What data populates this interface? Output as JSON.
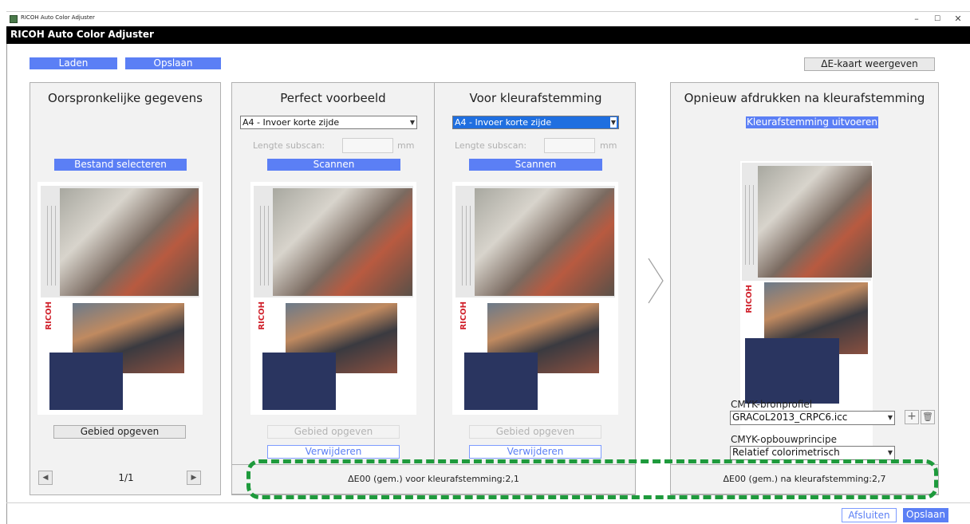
{
  "window": {
    "os_title": "RICOH Auto Color Adjuster",
    "app_title": "RICOH Auto Color Adjuster",
    "minimize": "–",
    "maximize": "☐",
    "close": "✕"
  },
  "toolbar": {
    "load_label": "Laden",
    "save_label": "Opslaan",
    "delta_e_map_label": "ΔE-kaart weergeven"
  },
  "original": {
    "title": "Oorspronkelijke gegevens",
    "select_file_label": "Bestand selecteren",
    "specify_area_label": "Gebied opgeven",
    "page_indicator": "1/1",
    "thumb_text": "RICOH"
  },
  "perfect": {
    "title": "Perfect voorbeeld",
    "paper_select": "A4 - Invoer korte zijde",
    "subscan_label": "Lengte subscan:",
    "subscan_unit": "mm",
    "scan_label": "Scannen",
    "specify_area_label": "Gebied opgeven",
    "delete_label": "Verwijderen",
    "thumb_text": "RICOH"
  },
  "before": {
    "title": "Voor kleurafstemming",
    "paper_select": "A4 - Invoer korte zijde",
    "subscan_label": "Lengte subscan:",
    "subscan_unit": "mm",
    "scan_label": "Scannen",
    "specify_area_label": "Gebied opgeven",
    "delete_label": "Verwijderen",
    "thumb_text": "RICOH"
  },
  "reprint": {
    "title": "Opnieuw afdrukken na kleurafstemming",
    "run_label": "Kleurafstemming uitvoeren",
    "cmyk_source_label": "CMYK-bronprofiel",
    "cmyk_source_value": "GRACoL2013_CRPC6.icc",
    "cmyk_build_label": "CMYK-opbouwprincipe",
    "cmyk_build_value": "Relatief colorimetrisch",
    "thumb_text": "RICOH"
  },
  "status": {
    "before_text": "ΔE00 (gem.) voor kleurafstemming:2,1",
    "after_text": "ΔE00 (gem.) na kleurafstemming:2,7"
  },
  "footer": {
    "close_label": "Afsluiten",
    "save_label": "Opslaan"
  },
  "colors": {
    "accent": "#5b7ff5",
    "highlight": "#1e9a3c",
    "title_bar": "#000000"
  }
}
